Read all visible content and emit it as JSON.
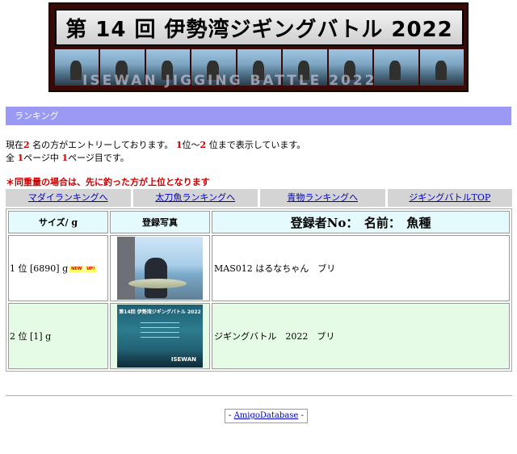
{
  "banner": {
    "title": "第 14 回 伊勢湾ジギングバトル 2022",
    "subtitle": "ISEWAN JIGGING BATTLE 2022"
  },
  "section": {
    "title": "ランキング"
  },
  "info": {
    "prefix": "現在",
    "entries": "2",
    "entries_suffix": " 名の方がエントリーしております。 ",
    "range_from": "1",
    "range_mid": "位〜",
    "range_to": "2",
    "range_suffix": " 位まで表示しています。",
    "page_prefix": "全 ",
    "pages_total": "1",
    "page_mid": "ページ中 ",
    "page_current": "1",
    "page_suffix": "ページ目です。"
  },
  "notice": "＊同重量の場合は、先に釣った方が上位となります",
  "nav": [
    {
      "label": "マダイランキングへ"
    },
    {
      "label": "太刀魚ランキングへ"
    },
    {
      "label": "青物ランキングへ"
    },
    {
      "label": "ジギングバトルTOP"
    }
  ],
  "table": {
    "headers": {
      "size": "サイズ/ g",
      "photo": "登録写真",
      "entry": "登録者No：　名前：　魚種"
    },
    "rows": [
      {
        "rank": "1 位 [6890] g",
        "badge_new": "NEW",
        "badge_up": "UP!",
        "entry": "MAS012 はるなちゃん　ブリ"
      },
      {
        "rank": "2 位 [1] g",
        "entry": "ジギングバトル　2022　ブリ",
        "photo": {
          "title": "第14回 伊勢湾ジギングバトル 2022",
          "logo": "ISEWAN"
        }
      }
    ]
  },
  "footer": {
    "prefix": "- ",
    "link": "AmigoDatabase",
    "suffix": " -"
  }
}
